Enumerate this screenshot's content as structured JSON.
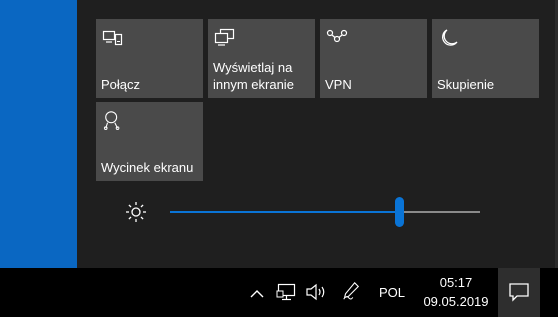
{
  "quick_actions": {
    "tiles": [
      {
        "label": "Połącz",
        "icon": "connect-icon"
      },
      {
        "label": "Wyświetlaj na innym ekranie",
        "icon": "project-icon"
      },
      {
        "label": "VPN",
        "icon": "vpn-icon"
      },
      {
        "label": "Skupienie",
        "icon": "moon-icon"
      },
      {
        "label": "Wycinek ekranu",
        "icon": "screen-snip-icon"
      }
    ]
  },
  "brightness": {
    "icon": "brightness-sun-icon",
    "level": 0.74
  },
  "taskbar": {
    "language": "POL",
    "time": "05:17",
    "date": "09.05.2019",
    "icons": [
      "chevron-up-icon",
      "network-icon",
      "volume-icon",
      "pen-icon",
      "notifications-icon"
    ]
  },
  "colors": {
    "accent": "#0a74d6",
    "tile_bg": "#4a4a4a",
    "panel_bg": "#1f1f1f",
    "desktop": "#0a67c2"
  }
}
